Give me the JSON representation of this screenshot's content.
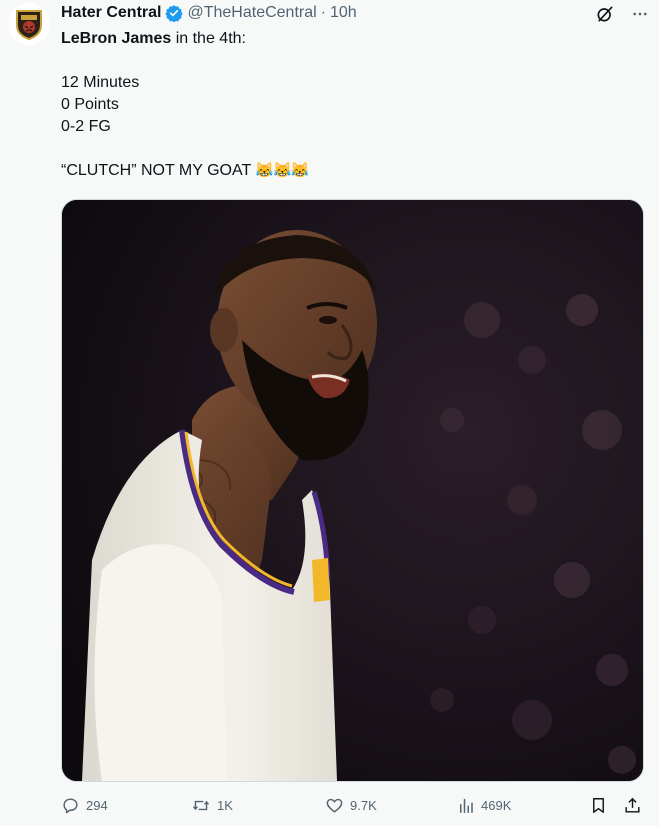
{
  "account": {
    "display_name": "Hater Central",
    "handle": "@TheHateCentral",
    "separator": "·",
    "time": "10h"
  },
  "tweet": {
    "line1_bold": "LeBron James",
    "line1_rest": " in the 4th:",
    "stats": [
      "12 Minutes",
      "0 Points",
      "0-2 FG"
    ],
    "closing_text": "“CLUTCH” NOT MY GOAT",
    "closing_emoji": "😹😹😹"
  },
  "media": {
    "description_icon": "photo-of-basketball-player"
  },
  "actions": {
    "replies": "294",
    "reposts": "1K",
    "likes": "9.7K",
    "views": "469K"
  },
  "colors": {
    "background": "#f7f9f9",
    "text": "#0f1419",
    "muted": "#536471",
    "verified": "#1d9bf0",
    "jersey": "#f2efe6",
    "lakers_purple": "#4b2a84",
    "lakers_gold": "#f3b82a"
  }
}
